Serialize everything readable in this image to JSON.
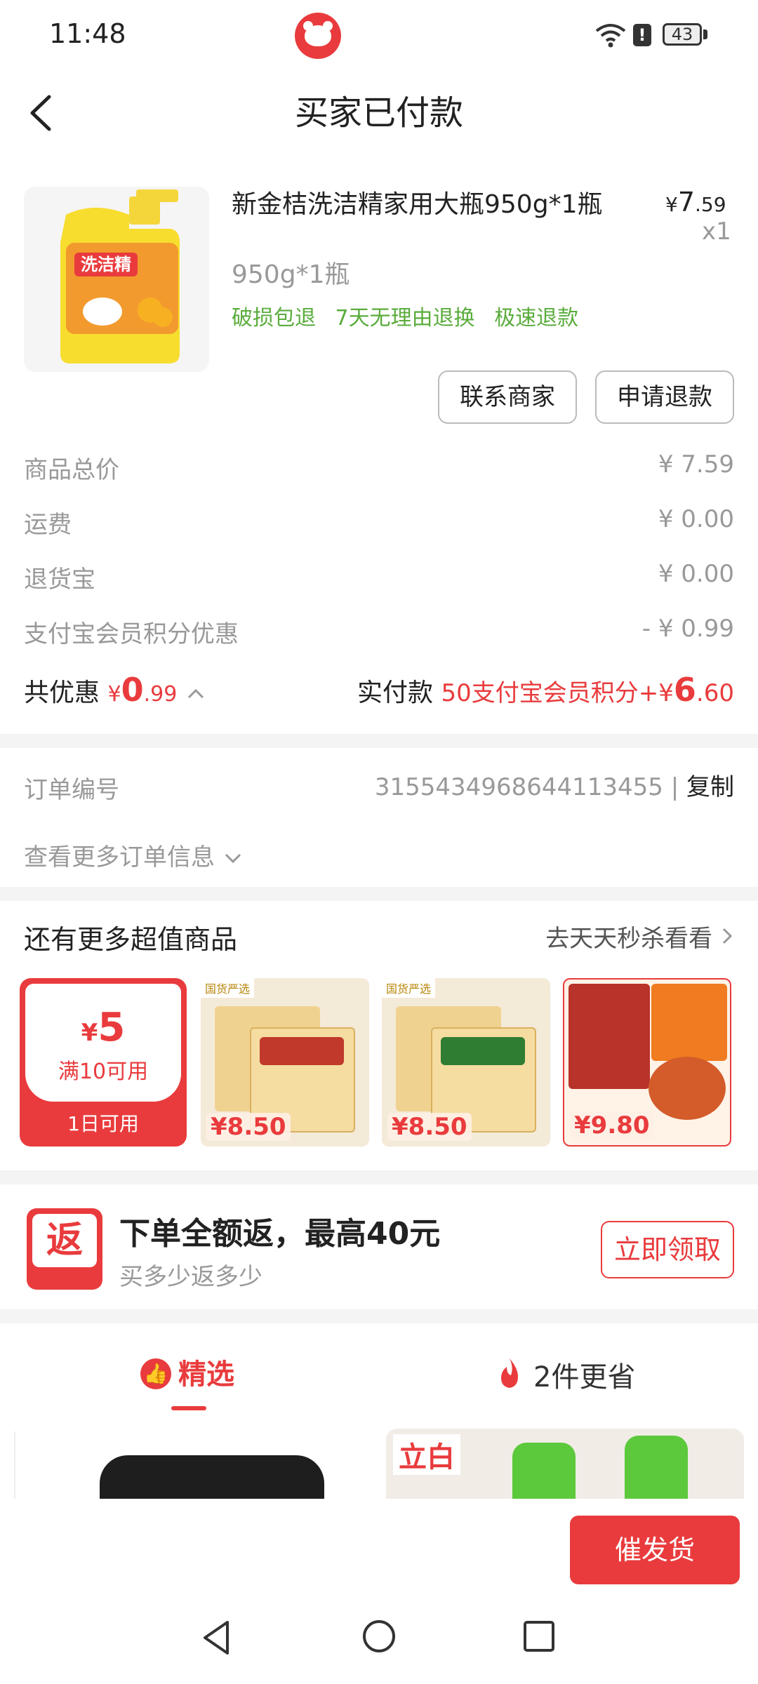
{
  "status_bar": {
    "time": "11:48",
    "battery": "43"
  },
  "header": {
    "title": "买家已付款"
  },
  "product": {
    "name": "新金桔洗洁精家用大瓶950g*1瓶",
    "price_symbol": "¥",
    "price_int": "7",
    "price_dec": ".59",
    "qty": "x1",
    "spec": "950g*1瓶",
    "tags": [
      "破损包退",
      "7天无理由退换",
      "极速退款"
    ],
    "image_text": "洗洁精",
    "buttons": {
      "contact": "联系商家",
      "refund": "申请退款"
    }
  },
  "fees": [
    {
      "label": "商品总价",
      "value": "¥ 7.59"
    },
    {
      "label": "运费",
      "value": "¥ 0.00"
    },
    {
      "label": "退货宝",
      "value": "¥ 0.00"
    },
    {
      "label": "支付宝会员积分优惠",
      "value": "- ¥ 0.99"
    }
  ],
  "summary": {
    "discount_label": "共优惠",
    "discount_symbol": "¥",
    "discount_int": "0",
    "discount_dec": ".99",
    "paid_label": "实付款",
    "paid_prefix": "50支付宝会员积分+¥",
    "paid_int": "6",
    "paid_dec": ".60"
  },
  "order": {
    "label": "订单编号",
    "number": "3155434968644113455",
    "separator": "|",
    "copy": "复制",
    "more": "查看更多订单信息"
  },
  "more_goods": {
    "title": "还有更多超值商品",
    "link": "去天天秒杀看看",
    "coupon": {
      "symbol": "¥",
      "amount": "5",
      "condition": "满10可用",
      "validity": "1日可用"
    },
    "items": [
      {
        "price": "¥8.50",
        "badge": "国货严选"
      },
      {
        "price": "¥8.50",
        "badge": "国货严选"
      },
      {
        "price": "¥9.80",
        "badge": ""
      }
    ]
  },
  "cashback": {
    "icon_char": "返",
    "title": "下单全额返，最高40元",
    "subtitle": "买多少返多少",
    "button": "立即领取"
  },
  "tabs": [
    {
      "label": "精选",
      "active": true
    },
    {
      "label": "2件更省",
      "active": false
    }
  ],
  "feed": {
    "brand_logo": "立白"
  },
  "bottom": {
    "urge_button": "催发货"
  },
  "colors": {
    "accent": "#e93b3d",
    "green_tag": "#5aac3c",
    "muted": "#999999"
  }
}
